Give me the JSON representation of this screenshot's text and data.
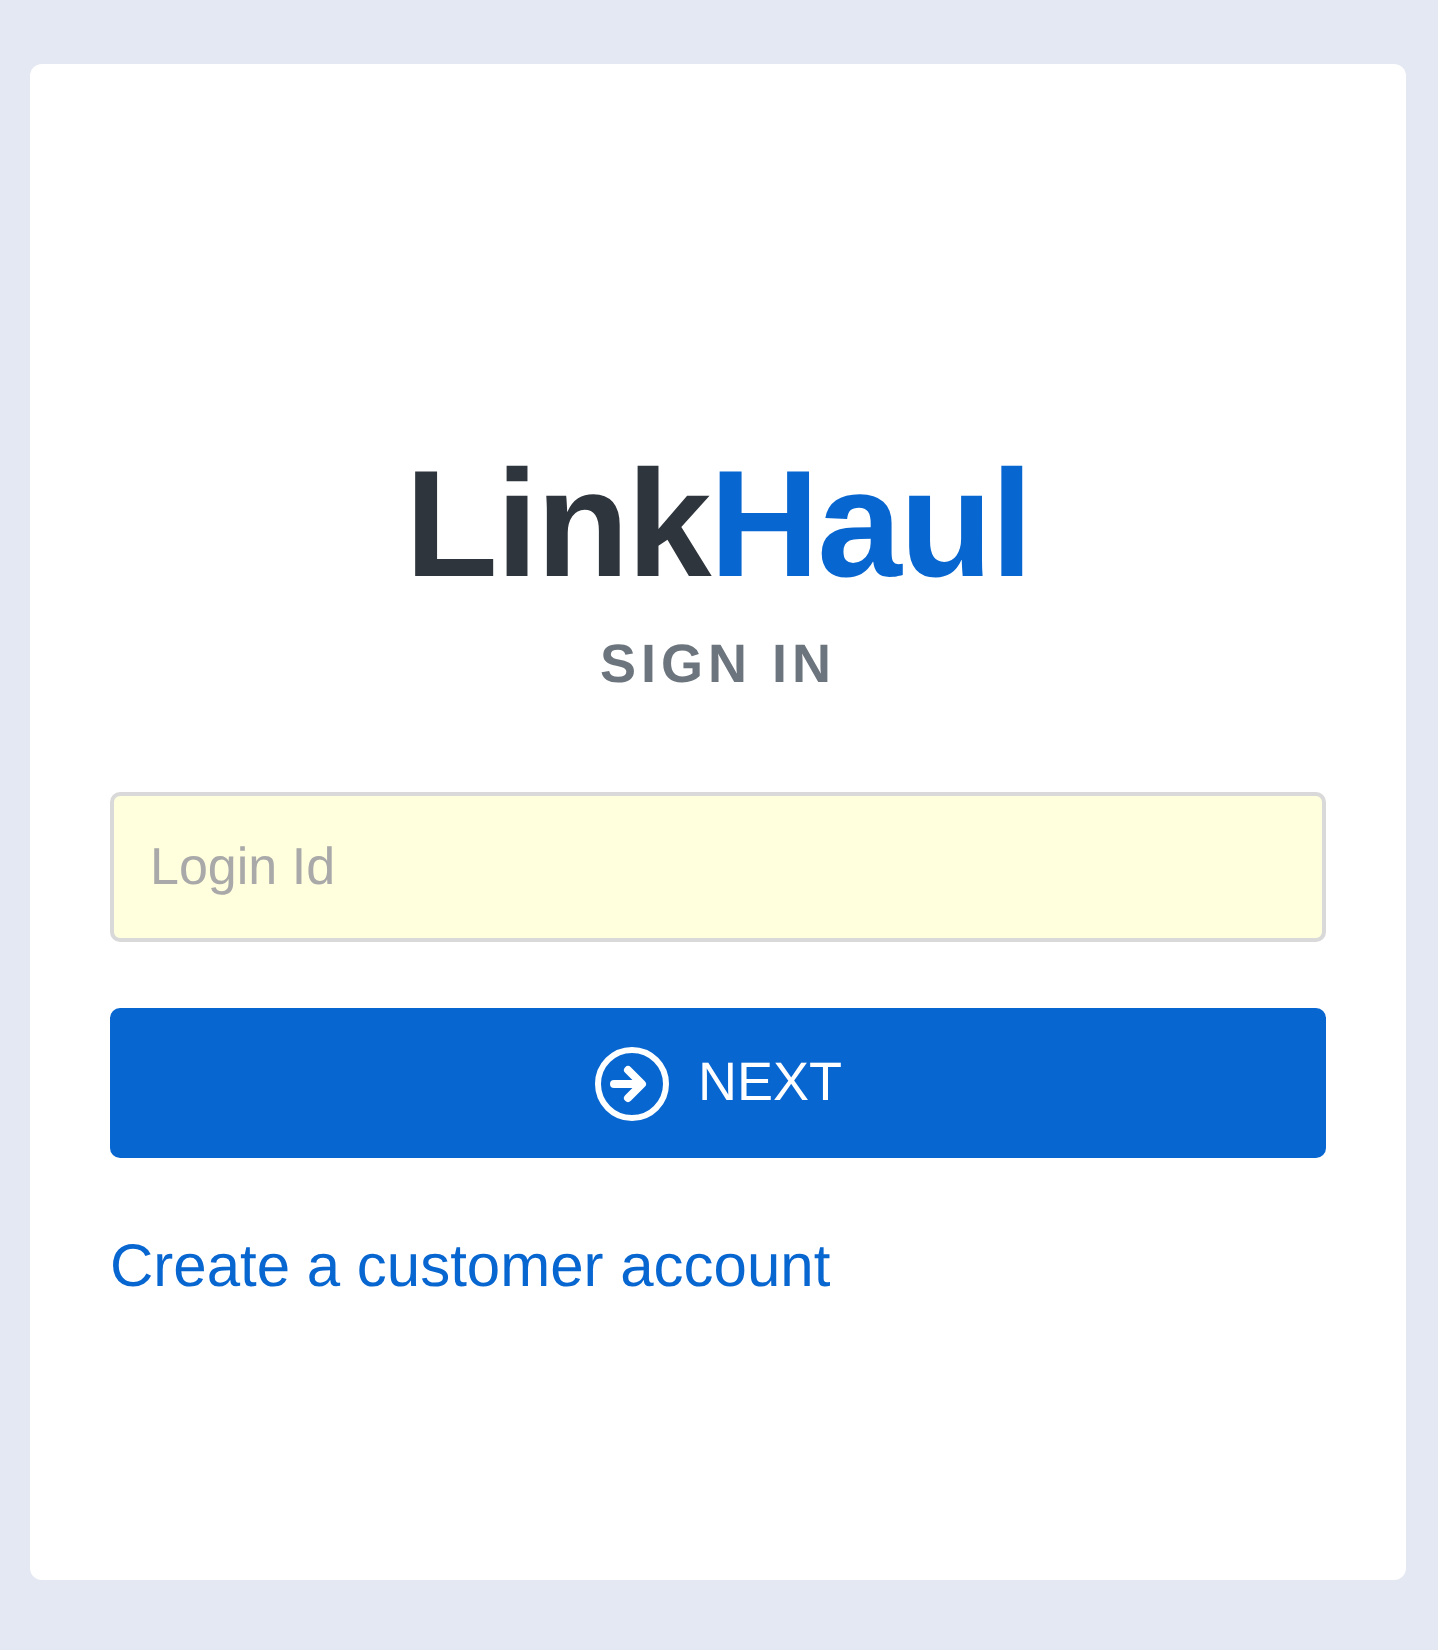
{
  "logo": [
    {
      "text": "Link",
      "color": "#2f353d"
    },
    {
      "text": "Haul",
      "color": "#0866d1"
    }
  ],
  "heading": "SIGN IN",
  "login_field": {
    "placeholder": "Login Id"
  },
  "next_button": {
    "label": "NEXT"
  },
  "create_account_link": "Create a customer account"
}
